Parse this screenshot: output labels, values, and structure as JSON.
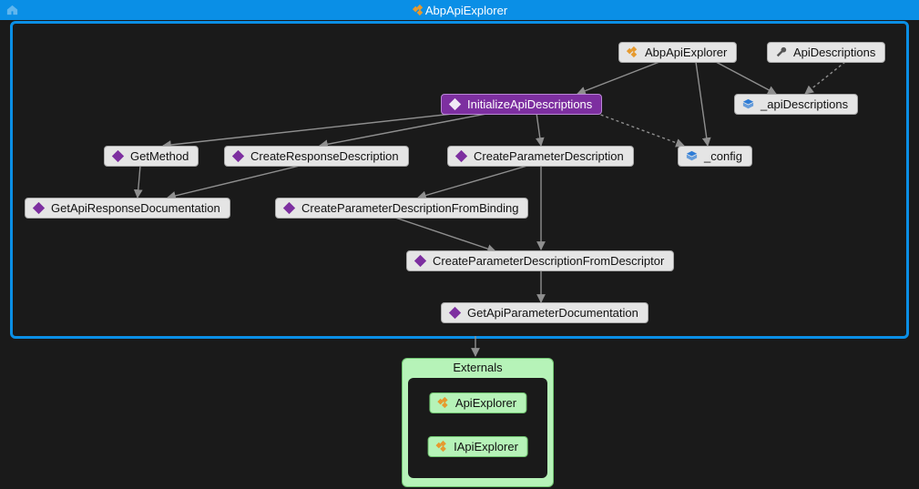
{
  "title": "AbpApiExplorer",
  "nodes": {
    "root": {
      "label": "AbpApiExplorer",
      "icon": "class"
    },
    "apiDesc": {
      "label": "ApiDescriptions",
      "icon": "wrench"
    },
    "init": {
      "label": "InitializeApiDescriptions",
      "icon": "method-white"
    },
    "apiDescField": {
      "label": "_apiDescriptions",
      "icon": "field"
    },
    "getMethod": {
      "label": "GetMethod",
      "icon": "method"
    },
    "createResp": {
      "label": "CreateResponseDescription",
      "icon": "method"
    },
    "createParam": {
      "label": "CreateParameterDescription",
      "icon": "method"
    },
    "config": {
      "label": "_config",
      "icon": "field"
    },
    "getApiResp": {
      "label": "GetApiResponseDocumentation",
      "icon": "method"
    },
    "fromBinding": {
      "label": "CreateParameterDescriptionFromBinding",
      "icon": "method"
    },
    "fromDescriptor": {
      "label": "CreateParameterDescriptionFromDescriptor",
      "icon": "method"
    },
    "getApiParam": {
      "label": "GetApiParameterDocumentation",
      "icon": "method"
    }
  },
  "externals": {
    "title": "Externals",
    "items": [
      {
        "label": "ApiExplorer",
        "icon": "class"
      },
      {
        "label": "IApiExplorer",
        "icon": "class"
      }
    ]
  }
}
